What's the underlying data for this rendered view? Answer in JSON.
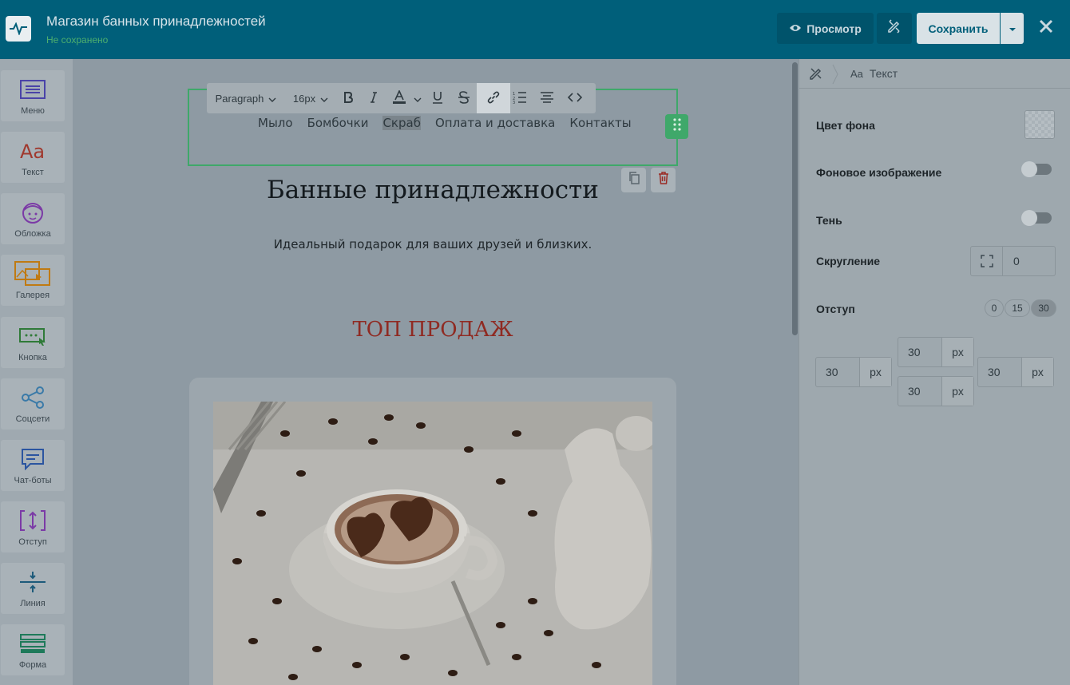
{
  "header": {
    "title": "Магазин банных принадлежностей",
    "status": "Не сохранено",
    "preview_label": "Просмотр",
    "save_label": "Сохранить"
  },
  "sidebar": {
    "items": [
      {
        "label": "Меню",
        "icon": "menu-icon",
        "color": "#4a43a8"
      },
      {
        "label": "Текст",
        "icon": "text-aa-icon",
        "color": "#a0392e"
      },
      {
        "label": "Обложка",
        "icon": "cover-face-icon",
        "color": "#7b3aa6"
      },
      {
        "label": "Галерея",
        "icon": "gallery-icon",
        "color": "#c07a12"
      },
      {
        "label": "Кнопка",
        "icon": "button-icon",
        "color": "#2f7a38"
      },
      {
        "label": "Соцсети",
        "icon": "share-icon",
        "color": "#3a7aa8"
      },
      {
        "label": "Чат-боты",
        "icon": "chat-icon",
        "color": "#2b55a0"
      },
      {
        "label": "Отступ",
        "icon": "spacing-icon",
        "color": "#7b3aa6"
      },
      {
        "label": "Линия",
        "icon": "divider-icon",
        "color": "#1d5a7a"
      },
      {
        "label": "Форма",
        "icon": "form-icon",
        "color": "#1e7a5a"
      }
    ]
  },
  "toolbar": {
    "paragraph_label": "Paragraph",
    "font_size_label": "16px"
  },
  "canvas": {
    "menu_links": [
      "Мыло",
      "Бомбочки",
      "Скраб",
      "Оплата и доставка",
      "Контакты"
    ],
    "selected_link": "Скраб",
    "heading": "Банные принадлежности",
    "subheading": "Идеальный подарок для ваших друзей и близких.",
    "section_title": "ТОП ПРОДАЖ"
  },
  "panel": {
    "breadcrumb_label": "Текст",
    "breadcrumb_prefix": "Aa",
    "bg_color_label": "Цвет фона",
    "bg_image_label": "Фоновое изображение",
    "shadow_label": "Тень",
    "radius_label": "Скругление",
    "radius_value": "0",
    "padding_label": "Отступ",
    "padding_presets": [
      "0",
      "15",
      "30"
    ],
    "padding_active": "30",
    "padding_unit": "px",
    "padding_values": {
      "top": "30",
      "left": "30",
      "right": "30",
      "bottom": "30"
    },
    "bg_image_enabled": false,
    "shadow_enabled": false
  },
  "colors": {
    "topbar": "#005f7a",
    "accent_green": "#3fa86a",
    "section_title": "#8f2a22"
  }
}
